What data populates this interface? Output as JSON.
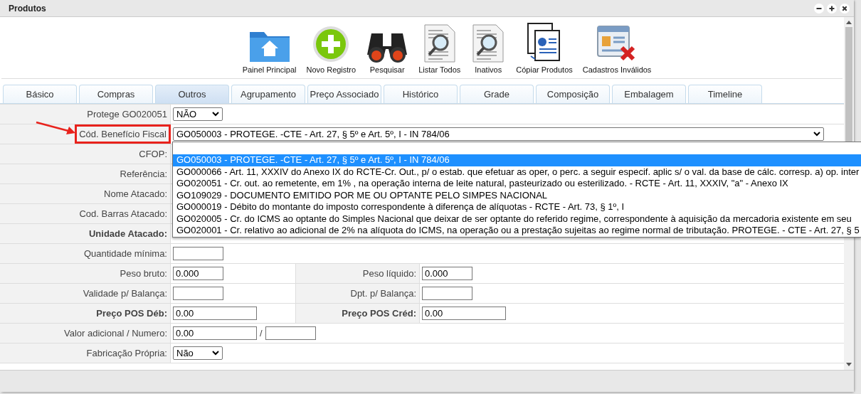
{
  "window": {
    "title": "Produtos"
  },
  "toolbar": [
    {
      "label": "Painel Principal",
      "kind": "folder"
    },
    {
      "label": "Novo Registro",
      "kind": "plus"
    },
    {
      "label": "Pesquisar",
      "kind": "binoculars"
    },
    {
      "label": "Listar Todos",
      "kind": "document"
    },
    {
      "label": "Inativos",
      "kind": "document"
    },
    {
      "label": "Cópiar Produtos",
      "kind": "copy"
    },
    {
      "label": "Cadastros Inválidos",
      "kind": "card"
    }
  ],
  "tabs": [
    {
      "label": "Básico",
      "selected": false
    },
    {
      "label": "Compras",
      "selected": false
    },
    {
      "label": "Outros",
      "selected": true
    },
    {
      "label": "Agrupamento",
      "selected": false
    },
    {
      "label": "Preço Associado",
      "selected": false
    },
    {
      "label": "Histórico",
      "selected": false
    },
    {
      "label": "Grade",
      "selected": false
    },
    {
      "label": "Composição",
      "selected": false
    },
    {
      "label": "Embalagem",
      "selected": false
    },
    {
      "label": "Timeline",
      "selected": false
    }
  ],
  "form": [
    {
      "kind": "single",
      "label": "Protege GO020051",
      "bold": false,
      "highlighted": false,
      "field": {
        "kind": "select",
        "value": "NÃO",
        "wide": false
      }
    },
    {
      "kind": "single",
      "label": "Cód. Benefício Fiscal",
      "bold": false,
      "highlighted": true,
      "field": {
        "kind": "select",
        "value": "GO050003 - PROTEGE. -CTE - Art. 27, § 5º e Art. 5º, I - IN 784/06",
        "wide": true
      }
    },
    {
      "kind": "single",
      "label": "CFOP:",
      "bold": false,
      "highlighted": false
    },
    {
      "kind": "single",
      "label": "Referência:",
      "bold": false,
      "highlighted": false
    },
    {
      "kind": "single",
      "label": "Nome Atacado:",
      "bold": false,
      "highlighted": false
    },
    {
      "kind": "single",
      "label": "Cod. Barras Atacado:",
      "bold": false,
      "highlighted": false
    },
    {
      "kind": "single",
      "label": "Unidade Atacado:",
      "bold": true,
      "highlighted": false
    },
    {
      "kind": "single",
      "label": "Quantidade mínima:",
      "bold": false,
      "highlighted": false,
      "field": {
        "kind": "text",
        "wide": false
      }
    },
    {
      "kind": "pair",
      "left": {
        "label": "Peso bruto:",
        "bold": false,
        "field": {
          "kind": "text",
          "value": "0.000",
          "wide": false
        }
      },
      "right": {
        "label": "Peso líquido:",
        "bold": false,
        "field": {
          "kind": "text",
          "value": "0.000",
          "wide": false
        }
      }
    },
    {
      "kind": "pair",
      "left": {
        "label": "Validade p/ Balança:",
        "bold": false,
        "field": {
          "kind": "text",
          "wide": false
        }
      },
      "right": {
        "label": "Dpt. p/ Balança:",
        "bold": false,
        "field": {
          "kind": "text",
          "wide": false
        }
      }
    },
    {
      "kind": "pair",
      "left": {
        "label": "Preço POS Déb:",
        "bold": true,
        "field": {
          "kind": "text",
          "value": "0.00",
          "wide": true
        }
      },
      "right": {
        "label": "Preço POS Créd:",
        "bold": true,
        "field": {
          "kind": "text",
          "value": "0.00",
          "wide": true
        }
      }
    },
    {
      "kind": "split",
      "label": "Valor adicional / Numero:",
      "bold": false,
      "highlighted": false,
      "field": {
        "kind": "text",
        "value": "0.00",
        "wide": true
      },
      "separator": "/",
      "field2": {
        "kind": "text",
        "wide": false
      }
    },
    {
      "kind": "single",
      "label": "Fabricação Própria:",
      "bold": false,
      "highlighted": false,
      "field": {
        "kind": "select",
        "value": "Não",
        "wide": false
      }
    }
  ],
  "dropdown": {
    "options": [
      {
        "text": "GO050003 - PROTEGE. -CTE - Art. 27, § 5º e Art. 5º, I - IN 784/06",
        "selected": true
      },
      {
        "text": "GO000066 - Art. 11, XXXIV do Anexo IX do RCTE-Cr. Out., p/ o estab. que efetuar as oper, o perc. a seguir especif. aplic s/ o val. da base de cálc. corresp. a) op. inter",
        "selected": false
      },
      {
        "text": "GO020051 - Cr. out. ao remetente, em 1% , na operação interna de leite natural, pasteurizado ou esterilizado. - RCTE - Art. 11, XXXIV, \"a\" - Anexo IX",
        "selected": false
      },
      {
        "text": "GO109029 - DOCUMENTO EMITIDO POR ME OU OPTANTE PELO SIMPES NACIONAL",
        "selected": false
      },
      {
        "text": "GO000019 - Débito do montante do imposto correspondente à diferença de alíquotas - RCTE - Art. 73, § 1º, I",
        "selected": false
      },
      {
        "text": "GO020005 - Cr. do ICMS ao optante do Simples Nacional que deixar de ser optante do referido regime, correspondente à aquisição da mercadoria existente em seu",
        "selected": false
      },
      {
        "text": "GO020001 - Cr. relativo ao adicional de 2% na alíquota do ICMS, na operação ou a prestação sujeitas ao regime normal de tributação. PROTEGE. - CTE - Art. 27, § 5",
        "selected": false
      }
    ]
  }
}
